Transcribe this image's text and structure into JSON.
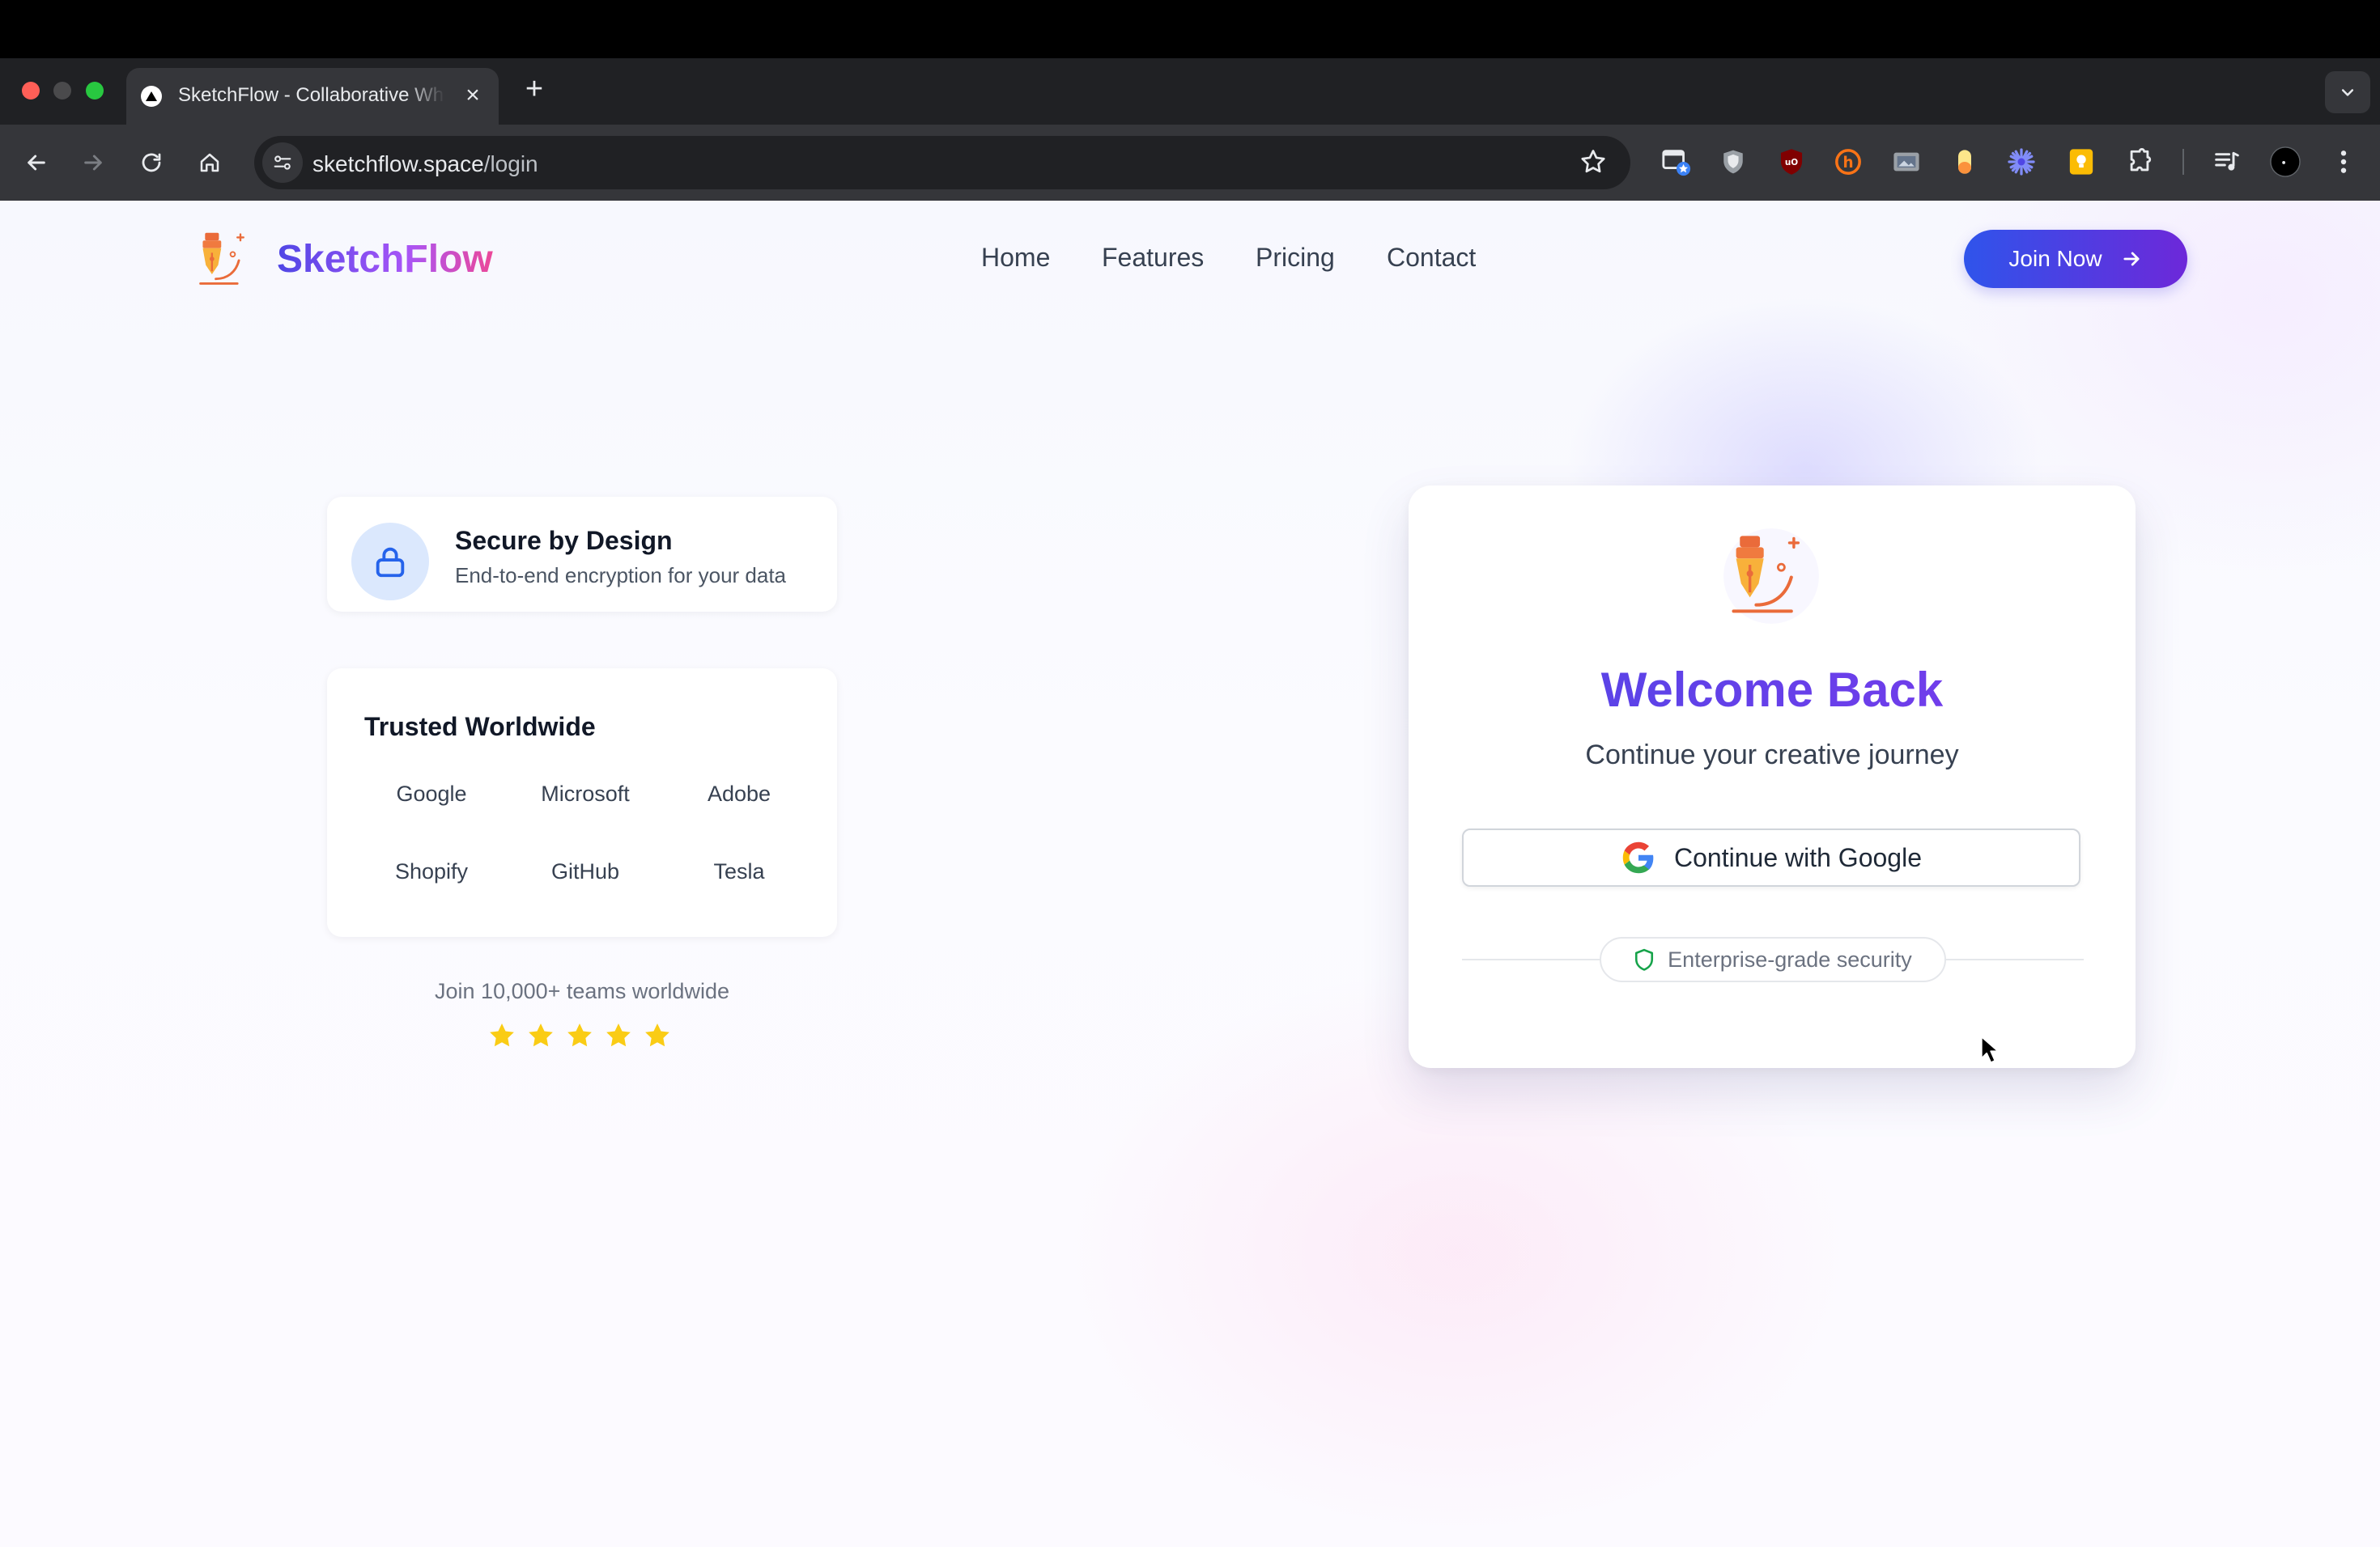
{
  "browser": {
    "tab_title": "SketchFlow - Collaborative Whiteboard",
    "tab_close": "×",
    "new_tab": "+",
    "url_domain": "sketchflow.space",
    "url_path": "/login"
  },
  "header": {
    "brand": "SketchFlow",
    "nav": [
      "Home",
      "Features",
      "Pricing",
      "Contact"
    ],
    "cta": "Join Now"
  },
  "secure": {
    "title": "Secure by Design",
    "subtitle": "End-to-end encryption for your data"
  },
  "trusted": {
    "title": "Trusted Worldwide",
    "companies": [
      "Google",
      "Microsoft",
      "Adobe",
      "Shopify",
      "GitHub",
      "Tesla"
    ]
  },
  "social_proof": {
    "text": "Join 10,000+ teams worldwide",
    "rating": 5
  },
  "login": {
    "title": "Welcome Back",
    "subtitle": "Continue your creative journey",
    "google_button": "Continue with Google",
    "security_badge": "Enterprise-grade security"
  },
  "colors": {
    "primary": "#4f46e5",
    "accent": "#7c3aed",
    "star": "#facc15",
    "security_green": "#16a34a"
  }
}
